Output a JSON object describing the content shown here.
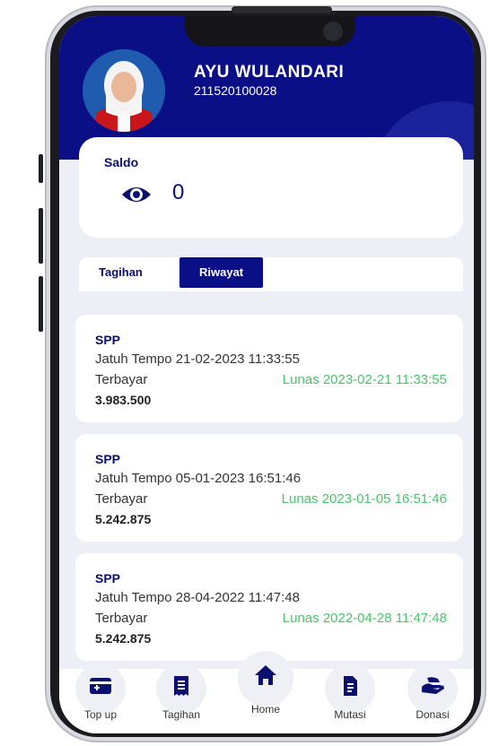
{
  "user": {
    "name": "AYU WULANDARI",
    "id": "211520100028"
  },
  "saldo": {
    "title": "Saldo",
    "value": "0",
    "icon": "eye-icon"
  },
  "tabs": [
    {
      "label": "Tagihan",
      "active": false
    },
    {
      "label": "Riwayat",
      "active": true
    }
  ],
  "history": [
    {
      "type": "SPP",
      "due": "Jatuh Tempo 21-02-2023 11:33:55",
      "paid_label": "Terbayar",
      "status": "Lunas 2023-02-21 11:33:55",
      "amount": "3.983.500"
    },
    {
      "type": "SPP",
      "due": "Jatuh Tempo 05-01-2023 16:51:46",
      "paid_label": "Terbayar",
      "status": "Lunas 2023-01-05 16:51:46",
      "amount": "5.242.875"
    },
    {
      "type": "SPP",
      "due": "Jatuh Tempo 28-04-2022 11:47:48",
      "paid_label": "Terbayar",
      "status": "Lunas 2022-04-28 11:47:48",
      "amount": "5.242.875"
    }
  ],
  "nav": [
    {
      "label": "Top up",
      "icon": "wallet-icon"
    },
    {
      "label": "Tagihan",
      "icon": "receipt-icon"
    },
    {
      "label": "Home",
      "icon": "home-icon"
    },
    {
      "label": "Mutasi",
      "icon": "document-icon"
    },
    {
      "label": "Donasi",
      "icon": "hand-money-icon"
    }
  ],
  "colors": {
    "primary": "#0b0f86",
    "status_paid": "#4cc36a",
    "background": "#eceff6"
  }
}
